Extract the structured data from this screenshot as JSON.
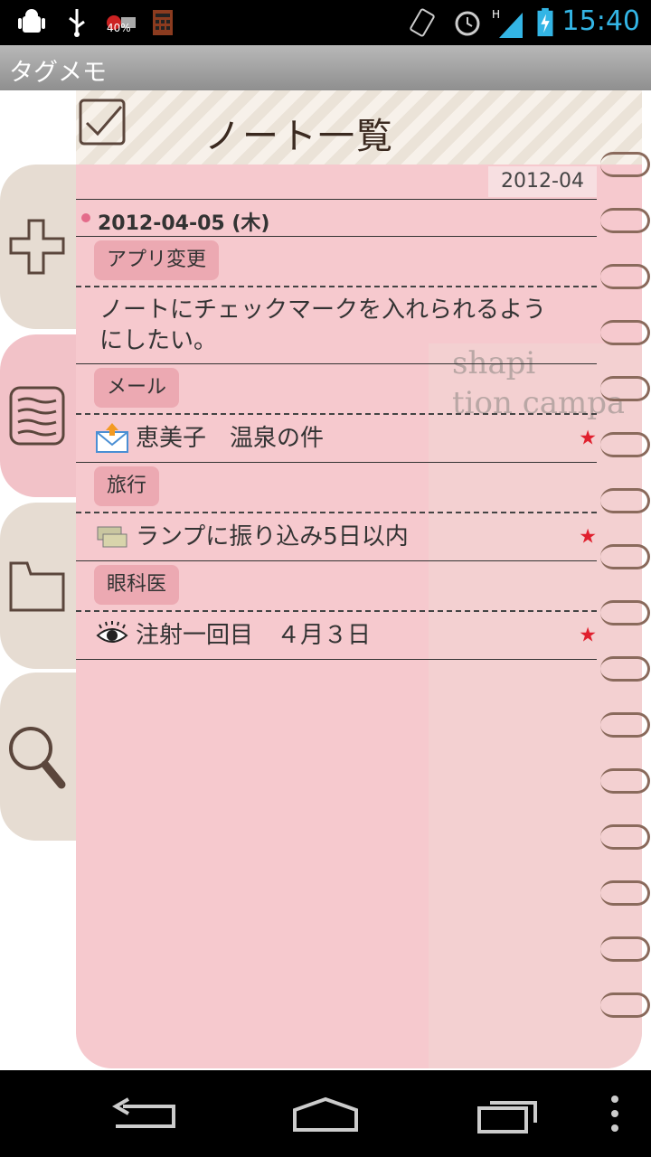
{
  "status": {
    "battery_pct": "40%",
    "time": "15:40"
  },
  "app_title": "タグメモ",
  "notebook": {
    "title": "ノート一覧",
    "paper_text": "shapi\ntion campai"
  },
  "month": "2012-04",
  "date_header": "2012-04-05 (木)",
  "notes": [
    {
      "tag": "アプリ変更",
      "text": "ノートにチェックマークを入れられるようにしたい。",
      "icon": "none",
      "starred": false
    },
    {
      "tag": "メール",
      "text": "恵美子　温泉の件",
      "icon": "mail-icon",
      "starred": true
    },
    {
      "tag": "旅行",
      "text": "ランプに振り込み5日以内",
      "icon": "money-icon",
      "starred": true
    },
    {
      "tag": "眼科医",
      "text": "注射一回目　４月３日",
      "icon": "eye-icon",
      "starred": true
    }
  ],
  "star_glyph": "★",
  "colors": {
    "status_time": "#33b5e5",
    "notebook_bg": "#f6c9ce",
    "tag_bg": "#eca9b2",
    "star": "#e0202e",
    "date_dot": "#e46b8a"
  }
}
